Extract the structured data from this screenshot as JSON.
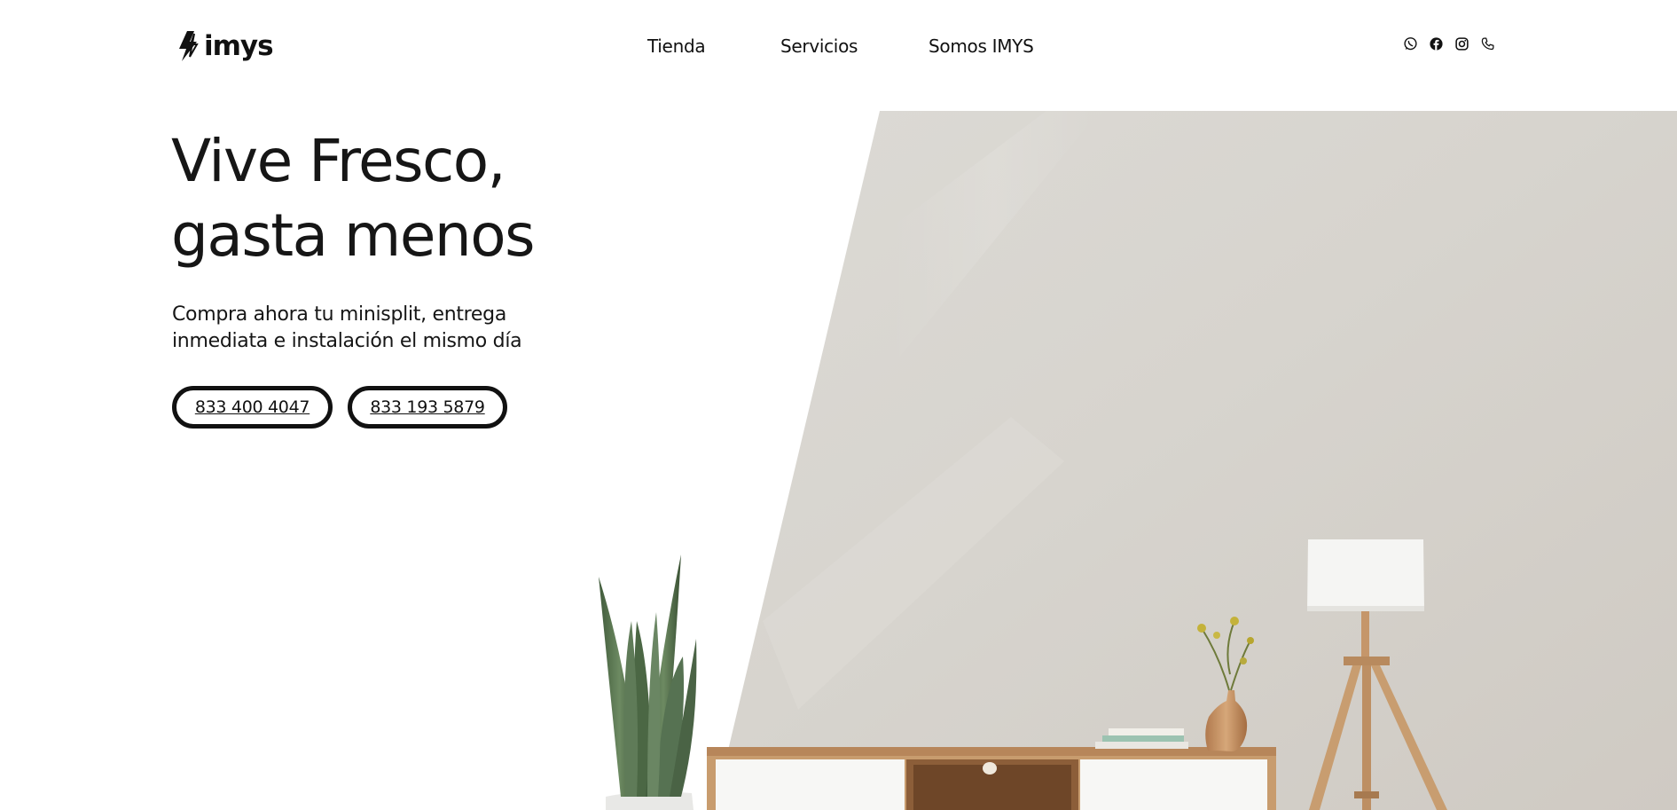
{
  "brand": {
    "name": "imys"
  },
  "nav": {
    "items": [
      {
        "label": "Tienda"
      },
      {
        "label": "Servicios"
      },
      {
        "label": "Somos IMYS"
      }
    ]
  },
  "social": {
    "icons": [
      "whatsapp-icon",
      "facebook-icon",
      "instagram-icon",
      "phone-icon"
    ]
  },
  "hero": {
    "title_line1": "Vive Fresco,",
    "title_line2": "gasta menos",
    "subtitle_line1": "Compra ahora tu minisplit, entrega",
    "subtitle_line2": "inmediata e instalación el mismo día",
    "buttons": [
      {
        "label": "833 400 4047"
      },
      {
        "label": "833 193 5879"
      }
    ]
  },
  "colors": {
    "text": "#111111",
    "wall": "#d9d6d1",
    "wood": "#c59a6a"
  }
}
